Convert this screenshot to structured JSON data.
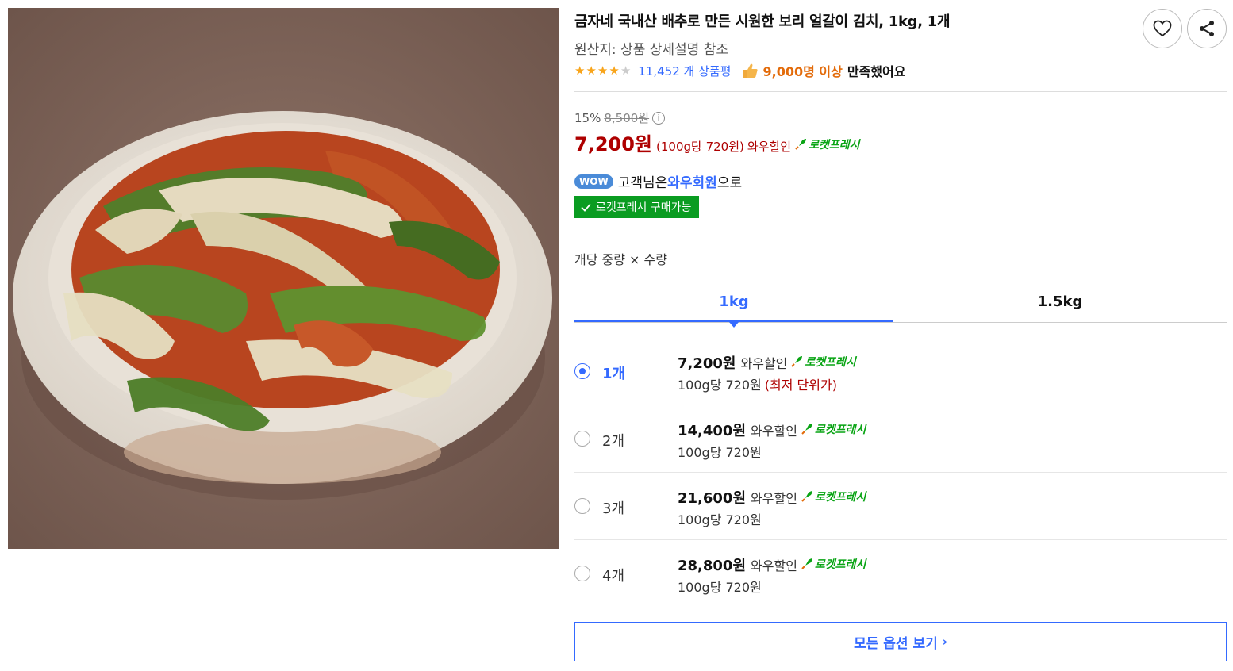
{
  "product": {
    "title": "금자네 국내산 배추로 만든 시원한 보리 얼갈이 김치, 1kg, 1개",
    "origin": "원산지: 상품 상세설명 참조",
    "rating_stars": 4,
    "review_count": "11,452 개 상품평",
    "satisfaction_count": "9,000명 이상",
    "satisfaction_text": "만족했어요"
  },
  "actions": {
    "wish_icon": "heart-icon",
    "share_icon": "share-icon"
  },
  "price": {
    "discount_rate": "15%",
    "original_price": "8,500원",
    "sale_price": "7,200원",
    "unit_price": "(100g당 720원)",
    "wow_discount": "와우할인",
    "rocket_label": "로켓프레시"
  },
  "wow": {
    "badge": "WOW",
    "text_before": "고객님은",
    "member": "와우회원",
    "text_after": "으로",
    "fresh_badge": "로켓프레시 구매가능"
  },
  "options": {
    "label": "개당 중량 × 수량",
    "tabs": [
      {
        "label": "1kg",
        "active": true
      },
      {
        "label": "1.5kg",
        "active": false
      }
    ],
    "items": [
      {
        "qty": "1개",
        "price": "7,200원",
        "wow": "와우할인",
        "rocket": "로켓프레시",
        "unit": "100g당 720원",
        "note": "(최저 단위가)",
        "selected": true
      },
      {
        "qty": "2개",
        "price": "14,400원",
        "wow": "와우할인",
        "rocket": "로켓프레시",
        "unit": "100g당 720원",
        "note": "",
        "selected": false
      },
      {
        "qty": "3개",
        "price": "21,600원",
        "wow": "와우할인",
        "rocket": "로켓프레시",
        "unit": "100g당 720원",
        "note": "",
        "selected": false
      },
      {
        "qty": "4개",
        "price": "28,800원",
        "wow": "와우할인",
        "rocket": "로켓프레시",
        "unit": "100g당 720원",
        "note": "",
        "selected": false
      }
    ],
    "view_all": "모든 옵션 보기"
  },
  "colors": {
    "accent_blue": "#346aff",
    "price_red": "#ae0000",
    "rocket_green": "#09a414",
    "badge_green": "#0a9c21",
    "satisfaction_orange": "#e36b0a"
  }
}
